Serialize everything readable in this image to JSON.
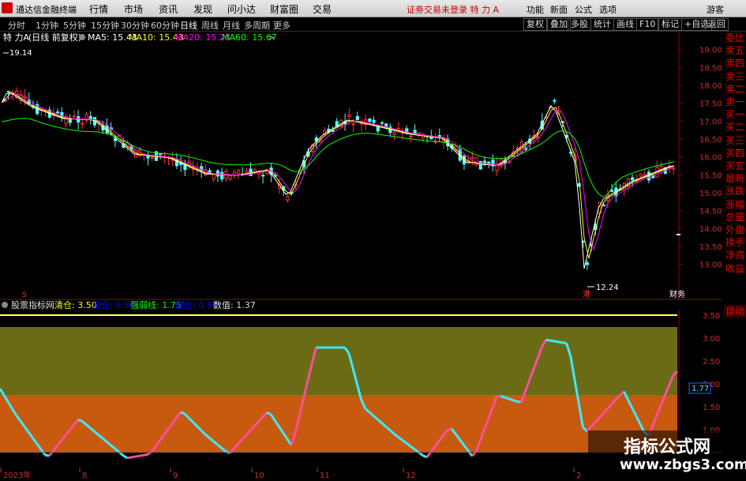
{
  "app": {
    "title": "通达信金融终端"
  },
  "menu": [
    "行情",
    "市场",
    "资讯",
    "发现",
    "问小达",
    "财富圈",
    "交易"
  ],
  "notice": "证劵交易未登录 特 力 A",
  "right_menu": [
    "功能",
    "新面",
    "公式",
    "选项",
    "游客"
  ],
  "periods": [
    "分时",
    "1分钟",
    "5分钟",
    "15分钟",
    "30分钟",
    "60分钟",
    "日线",
    "周线",
    "月线",
    "多周期",
    "更多"
  ],
  "active_period": "日线",
  "right_buttons": [
    "复权",
    "叠加",
    "多股",
    "统计",
    "画线",
    "F10",
    "标记",
    "+自选",
    "返回"
  ],
  "stock": {
    "name": "特 力A",
    "mode": "(日线 前复权)"
  },
  "ma": [
    {
      "label": "MA5: 15.43",
      "color": "#ffffff"
    },
    {
      "label": "MA10: 15.43",
      "color": "#ffff00"
    },
    {
      "label": "MA20: 15.28",
      "color": "#ff00ff"
    },
    {
      "label": "MA60: 15.67",
      "color": "#00ff00"
    }
  ],
  "annotations": {
    "high": "19.14",
    "low": "12.24",
    "caiwu": "财务",
    "gang": "港",
    "s_mark": "S"
  },
  "price_axis": [
    "19.00",
    "18.50",
    "18.00",
    "17.50",
    "17.00",
    "16.50",
    "16.00",
    "15.50",
    "15.00",
    "14.50",
    "14.00",
    "13.50",
    "13.00"
  ],
  "right_panel": [
    "委比",
    "卖五",
    "卖四",
    "卖三",
    "卖二",
    "卖一",
    "买一",
    "买二",
    "买三",
    "买四",
    "买五",
    "最新",
    "涨跌",
    "涨幅",
    "总量",
    "外盘",
    "换手",
    "净资",
    "收益"
  ],
  "auto_label": "自动",
  "indicator": {
    "name": "股票指标网",
    "params": [
      {
        "label": "清仓: 3.50",
        "color": "#ffff00"
      },
      {
        "label": "增仓: 0.50",
        "color": "#0000ff"
      },
      {
        "label": "强弱线: 1.75",
        "color": "#00ff00"
      },
      {
        "label": "建仓: 0.50",
        "color": "#0000ff"
      },
      {
        "label": "数值: 1.37",
        "color": "#dddddd"
      }
    ],
    "axis": [
      "3.50",
      "3.00",
      "2.50",
      "2.00",
      "1.50",
      "1.00"
    ],
    "current": "1.77"
  },
  "date_labels": [
    "2023年",
    "8",
    "9",
    "10",
    "11",
    "12",
    "2"
  ],
  "watermark": {
    "line1": "指标公式网",
    "line2": "www.zbgs3.com"
  },
  "colors": {
    "up": "#ff3232",
    "down": "#54fcfc",
    "zone_top": "#6b6b16",
    "zone_bottom": "#c85a10",
    "pink": "#ff4d9a",
    "cyan": "#3ee8ff"
  }
}
